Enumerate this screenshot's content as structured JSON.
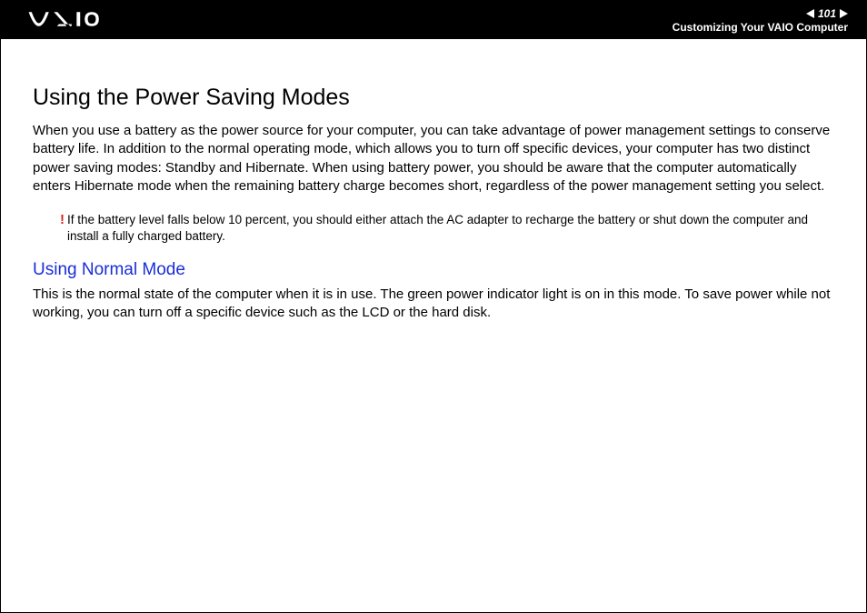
{
  "header": {
    "page_number": "101",
    "section": "Customizing Your VAIO Computer"
  },
  "content": {
    "main_heading": "Using the Power Saving Modes",
    "paragraph1": "When you use a battery as the power source for your computer, you can take advantage of power management settings to conserve battery life. In addition to the normal operating mode, which allows you to turn off specific devices, your computer has two distinct power saving modes: Standby and Hibernate. When using battery power, you should be aware that the computer automatically enters Hibernate mode when the remaining battery charge becomes short, regardless of the power management setting you select.",
    "note_icon": "!",
    "note_text": "If the battery level falls below 10 percent, you should either attach the AC adapter to recharge the battery or shut down the computer and install a fully charged battery.",
    "sub_heading": "Using Normal Mode",
    "paragraph2": "This is the normal state of the computer when it is in use. The green power indicator light is on in this mode. To save power while not working, you can turn off a specific device such as the LCD or the hard disk."
  }
}
